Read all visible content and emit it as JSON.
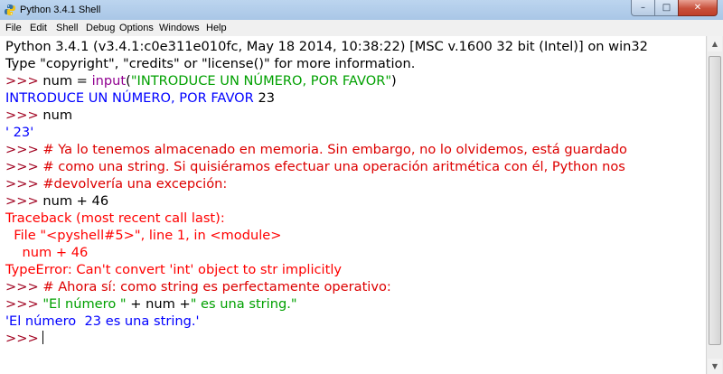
{
  "window": {
    "title": "Python 3.4.1 Shell",
    "controls": {
      "minimize": "–",
      "maximize": "□",
      "close": "✕"
    }
  },
  "menu": [
    "File",
    "Edit",
    "Shell",
    "Debug",
    "Options",
    "Windows",
    "Help"
  ],
  "colors": {
    "prompt": "#a0001f",
    "builtin": "#900090",
    "string": "#00a000",
    "stdout": "#0000ff",
    "comment": "#dd0000",
    "error": "#ff0000"
  },
  "shell": {
    "banner1": "Python 3.4.1 (v3.4.1:c0e311e010fc, May 18 2014, 10:38:22) [MSC v.1600 32 bit (Intel)] on win32",
    "banner2": "Type \"copyright\", \"credits\" or \"license()\" for more information.",
    "prompt": ">>> ",
    "l3_a": "num = ",
    "l3_builtin": "input",
    "l3_b": "(",
    "l3_string": "\"INTRODUCE UN NÚMERO, POR FAVOR\"",
    "l3_c": ")",
    "l4_stdout": "INTRODUCE UN NÚMERO, POR FAVOR ",
    "l4_input": "23",
    "l5_code": "num",
    "l6_out": "' 23'",
    "l7_comment": "# Ya lo tenemos almacenado en memoria. Sin embargo, no lo olvidemos, está guardado",
    "l8_comment": "# como una string. Si quisiéramos efectuar una operación aritmética con él, Python nos",
    "l9_comment": "#devolvería una excepción:",
    "l10_code": "num + 46",
    "tb1": "Traceback (most recent call last):",
    "tb2": "  File \"<pyshell#5>\", line 1, in <module>",
    "tb3": "    num + 46",
    "tb4": "TypeError: Can't convert 'int' object to str implicitly",
    "l15_comment": "# Ahora sí: como string es perfectamente operativo:",
    "l16_str1": "\"El número \"",
    "l16_mid": " + num +",
    "l16_str2": "\" es una string.\"",
    "l17_out": "'El número  23 es una string.'",
    "l18_prompt": ">>> "
  }
}
